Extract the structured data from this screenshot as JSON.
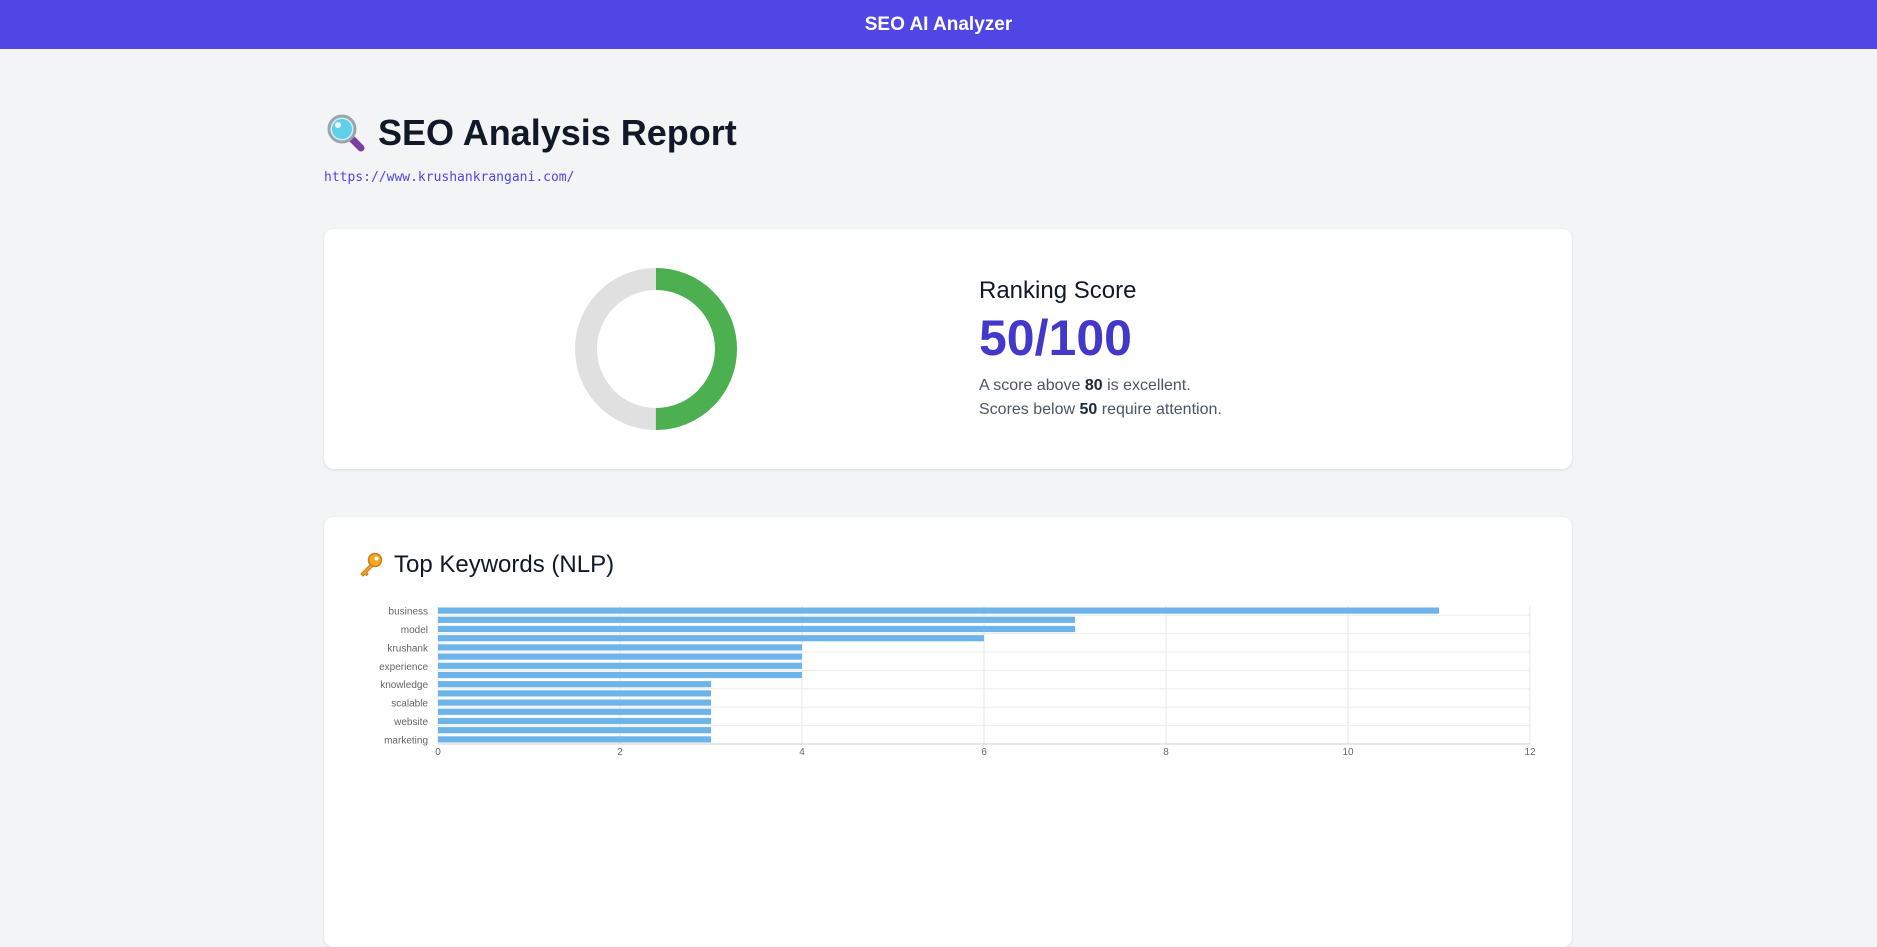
{
  "header": {
    "title": "SEO AI Analyzer"
  },
  "report": {
    "title": "SEO Analysis Report",
    "url": "https://www.krushankrangani.com/"
  },
  "score": {
    "label": "Ranking Score",
    "value_text": "50/100",
    "value": 50,
    "max": 100,
    "note_line1_prefix": "A score above ",
    "note_line1_bold": "80",
    "note_line1_suffix": " is excellent.",
    "note_line2_prefix": "Scores below ",
    "note_line2_bold": "50",
    "note_line2_suffix": " require attention.",
    "fill_color": "#4caf50",
    "track_color": "#e0e0e0"
  },
  "keywords": {
    "title": "Top Keywords (NLP)",
    "icons": {
      "title": "search-icon",
      "keywords": "key-icon"
    }
  },
  "chart_data": {
    "type": "bar",
    "orientation": "horizontal",
    "bar_count": 15,
    "labeled_rows": [
      {
        "row": 0,
        "label": "business"
      },
      {
        "row": 2,
        "label": "model"
      },
      {
        "row": 4,
        "label": "krushank"
      },
      {
        "row": 6,
        "label": "experience"
      },
      {
        "row": 8,
        "label": "knowledge"
      },
      {
        "row": 10,
        "label": "scalable"
      },
      {
        "row": 12,
        "label": "website"
      },
      {
        "row": 14,
        "label": "marketing"
      }
    ],
    "values": [
      11,
      7,
      7,
      6,
      4,
      4,
      4,
      4,
      3,
      3,
      3,
      3,
      3,
      3,
      3
    ],
    "xlim": [
      0,
      12
    ],
    "xticks": [
      0,
      2,
      4,
      6,
      8,
      10,
      12
    ],
    "grid": true,
    "bar_color": "#6cb4ea"
  }
}
